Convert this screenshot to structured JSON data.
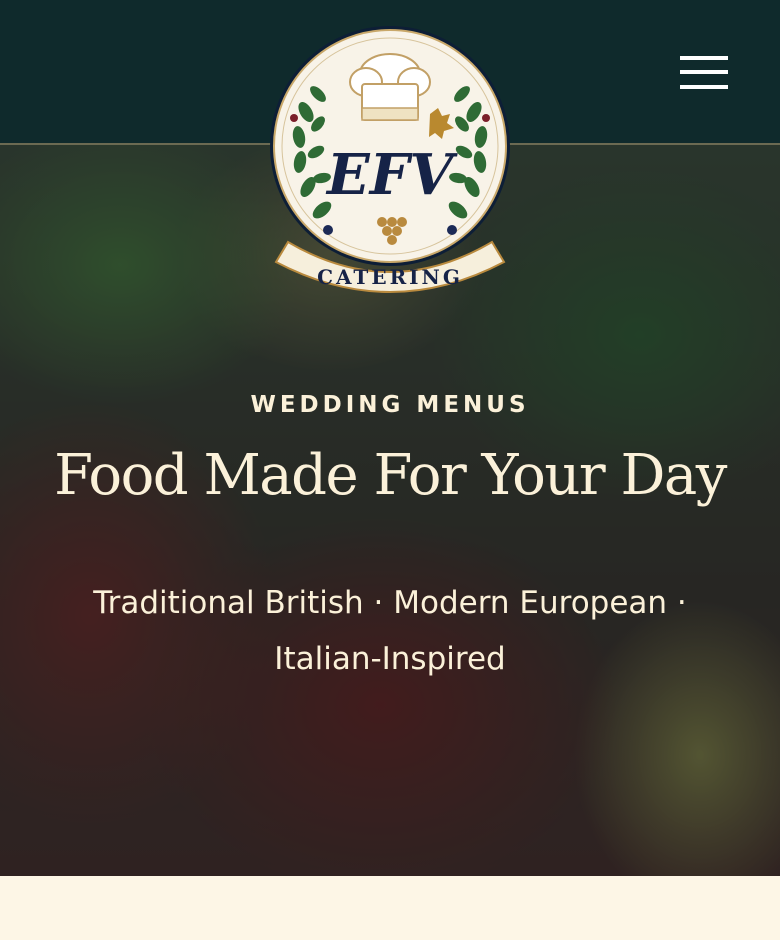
{
  "header": {
    "logo": {
      "monogram": "EFV",
      "wordmark": "CATERING",
      "icon": "chef-hat-laurel-crest"
    },
    "menu": {
      "icon": "hamburger-menu-icon"
    }
  },
  "hero": {
    "eyebrow": "WEDDING MENUS",
    "title": "Food Made For Your Day",
    "subtitle": "Traditional British · Modern European · Italian-Inspired",
    "background": "photo of plated food with red sauce and green herbs"
  },
  "colors": {
    "header_bg": "#0f2a2c",
    "text_cream": "#fbf1d9",
    "page_bg": "#fdf6e6",
    "navy": "#162347",
    "gold": "#b98a3e"
  }
}
